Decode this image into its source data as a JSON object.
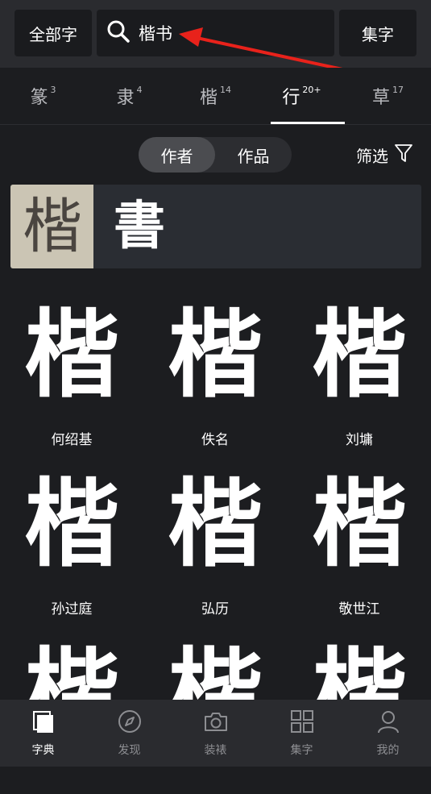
{
  "header": {
    "all_label": "全部字",
    "search_query": "楷书",
    "collect_label": "集字"
  },
  "tabs": [
    {
      "label": "篆",
      "count": "3"
    },
    {
      "label": "隶",
      "count": "4"
    },
    {
      "label": "楷",
      "count": "14"
    },
    {
      "label": "行",
      "count": "20+"
    },
    {
      "label": "草",
      "count": "17"
    }
  ],
  "segment": {
    "author_label": "作者",
    "works_label": "作品"
  },
  "filter_label": "筛选",
  "banner": {
    "image_char": "楷",
    "title_char": "書"
  },
  "grid": [
    {
      "glyph": "楷",
      "author": "何绍基"
    },
    {
      "glyph": "楷",
      "author": "佚名"
    },
    {
      "glyph": "楷",
      "author": "刘墉"
    },
    {
      "glyph": "楷",
      "author": "孙过庭"
    },
    {
      "glyph": "楷",
      "author": "弘历"
    },
    {
      "glyph": "楷",
      "author": "敬世江"
    },
    {
      "glyph": "楷",
      "author": ""
    },
    {
      "glyph": "楷",
      "author": ""
    },
    {
      "glyph": "楷",
      "author": ""
    }
  ],
  "bottom_nav": [
    {
      "label": "字典",
      "icon": "dictionary-icon"
    },
    {
      "label": "发现",
      "icon": "compass-icon"
    },
    {
      "label": "装裱",
      "icon": "camera-icon"
    },
    {
      "label": "集字",
      "icon": "grid-icon"
    },
    {
      "label": "我的",
      "icon": "user-icon"
    }
  ],
  "colors": {
    "background": "#1c1d20",
    "topbar": "#2a2b2f",
    "arrow": "#e8221b"
  }
}
